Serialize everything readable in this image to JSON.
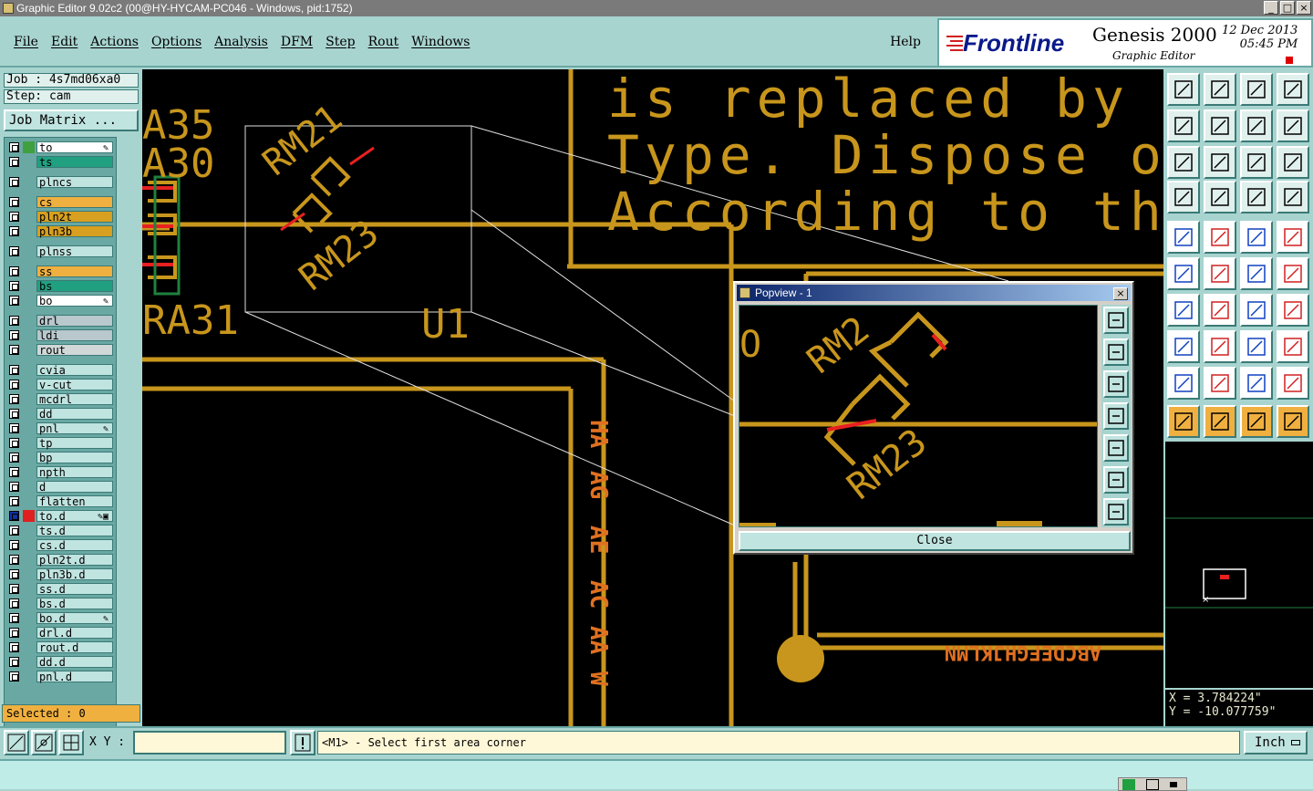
{
  "window": {
    "title": "Graphic Editor 9.02c2 (00@HY-HYCAM-PC046 - Windows, pid:1752)",
    "buttons": [
      "_",
      "□",
      "×"
    ]
  },
  "menu": {
    "items": [
      "File",
      "Edit",
      "Actions",
      "Options",
      "Analysis",
      "DFM",
      "Step",
      "Rout",
      "Windows"
    ],
    "help": "Help"
  },
  "brand": {
    "logo": "Frontline",
    "product": "Genesis 2000",
    "subtitle": "Graphic Editor",
    "date": "12 Dec 2013",
    "time": "05:45 PM"
  },
  "job": {
    "job_label": "Job : 4s7md06xa0",
    "step_label": "Step: cam",
    "matrix_button": "Job Matrix ..."
  },
  "layers": [
    {
      "name": "to",
      "color": "#ffffff",
      "swatch": "#40a040",
      "mark": "✎"
    },
    {
      "name": "ts",
      "color": "#20a080",
      "swatch": "",
      "mark": ""
    },
    {
      "name": "plncs",
      "color": "#c0e4e0",
      "swatch": "",
      "mark": ""
    },
    {
      "name": "cs",
      "color": "#f0b040",
      "swatch": "",
      "mark": ""
    },
    {
      "name": "pln2t",
      "color": "#d8a020",
      "swatch": "",
      "mark": ""
    },
    {
      "name": "pln3b",
      "color": "#d8a020",
      "swatch": "",
      "mark": ""
    },
    {
      "name": "plnss",
      "color": "#c0e4e0",
      "swatch": "",
      "mark": ""
    },
    {
      "name": "ss",
      "color": "#f0b040",
      "swatch": "",
      "mark": ""
    },
    {
      "name": "bs",
      "color": "#20a080",
      "swatch": "",
      "mark": ""
    },
    {
      "name": "bo",
      "color": "#ffffff",
      "swatch": "",
      "mark": "✎"
    },
    {
      "name": "drl",
      "color": "#b8c8cc",
      "swatch": "",
      "mark": ""
    },
    {
      "name": "ldi",
      "color": "#b8c8cc",
      "swatch": "",
      "mark": ""
    },
    {
      "name": "rout",
      "color": "#d0d8d8",
      "swatch": "",
      "mark": ""
    },
    {
      "name": "cvia",
      "color": "#c0e4e0",
      "swatch": "",
      "mark": ""
    },
    {
      "name": "v-cut",
      "color": "#c0e4e0",
      "swatch": "",
      "mark": ""
    },
    {
      "name": "mcdrl",
      "color": "#c0e4e0",
      "swatch": "",
      "mark": ""
    },
    {
      "name": "dd",
      "color": "#c0e4e0",
      "swatch": "",
      "mark": ""
    },
    {
      "name": "pnl",
      "color": "#c0e4e0",
      "swatch": "",
      "mark": "✎"
    },
    {
      "name": "tp",
      "color": "#c0e4e0",
      "swatch": "",
      "mark": ""
    },
    {
      "name": "bp",
      "color": "#c0e4e0",
      "swatch": "",
      "mark": ""
    },
    {
      "name": "npth",
      "color": "#c0e4e0",
      "swatch": "",
      "mark": ""
    },
    {
      "name": "d",
      "color": "#c0e4e0",
      "swatch": "",
      "mark": ""
    },
    {
      "name": "flatten",
      "color": "#c0e4e0",
      "swatch": "",
      "mark": ""
    },
    {
      "name": "to.d",
      "color": "#c0e4e0",
      "swatch": "#e02020",
      "mark": "✎▣",
      "active": true
    },
    {
      "name": "ts.d",
      "color": "#c0e4e0",
      "swatch": "",
      "mark": ""
    },
    {
      "name": "cs.d",
      "color": "#c0e4e0",
      "swatch": "",
      "mark": ""
    },
    {
      "name": "pln2t.d",
      "color": "#c0e4e0",
      "swatch": "",
      "mark": ""
    },
    {
      "name": "pln3b.d",
      "color": "#c0e4e0",
      "swatch": "",
      "mark": ""
    },
    {
      "name": "ss.d",
      "color": "#c0e4e0",
      "swatch": "",
      "mark": ""
    },
    {
      "name": "bs.d",
      "color": "#c0e4e0",
      "swatch": "",
      "mark": ""
    },
    {
      "name": "bo.d",
      "color": "#c0e4e0",
      "swatch": "",
      "mark": "✎"
    },
    {
      "name": "drl.d",
      "color": "#c0e4e0",
      "swatch": "",
      "mark": ""
    },
    {
      "name": "rout.d",
      "color": "#c0e4e0",
      "swatch": "",
      "mark": ""
    },
    {
      "name": "dd.d",
      "color": "#c0e4e0",
      "swatch": "",
      "mark": ""
    },
    {
      "name": "pnl.d",
      "color": "#c0e4e0",
      "swatch": "",
      "mark": ""
    }
  ],
  "selected": "Selected : 0",
  "canvas": {
    "text_line1": "is replaced by an",
    "text_line2": "Type. Dispose of U",
    "text_line3": "According to the",
    "labels": [
      "A35",
      "A30",
      "RA31",
      "U1",
      "RM21",
      "RM23"
    ]
  },
  "popview": {
    "title": "Popview - 1",
    "close_label": "Close",
    "labels": [
      "RM2",
      "RM23"
    ]
  },
  "coords": {
    "x": "X = 3.784224\"",
    "y": "Y = -10.077759\""
  },
  "bottom": {
    "xy_label": "X Y :",
    "xy_value": "",
    "prompt": "<M1> - Select first area corner",
    "unit": "Inch"
  },
  "colors": {
    "trace": "#c8961c",
    "highlight": "#e82020",
    "panel": "#a8d4d0"
  }
}
